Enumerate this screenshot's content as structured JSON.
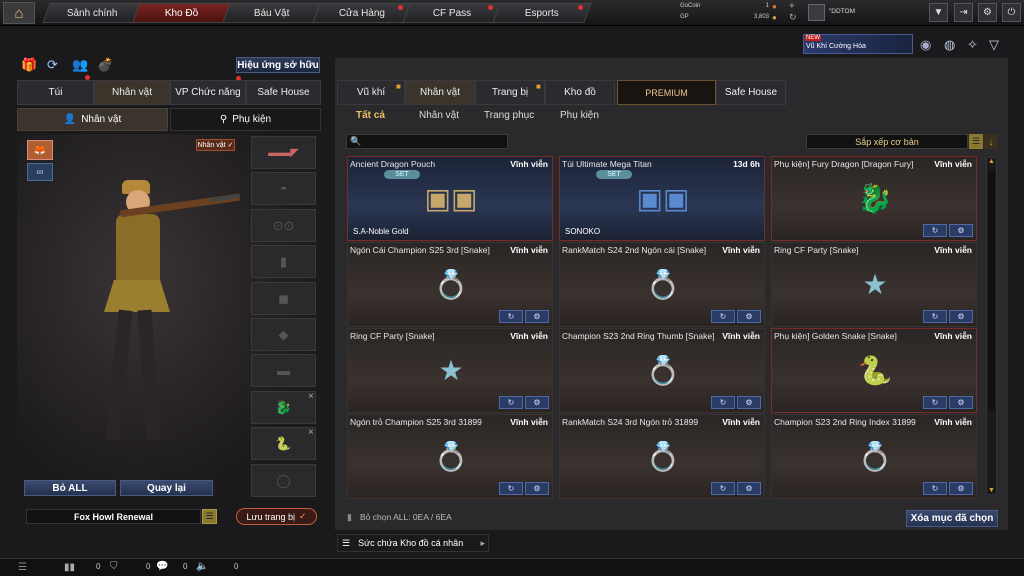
{
  "nav": {
    "tabs": [
      "Sảnh chính",
      "Kho Đồ",
      "Báu Vật",
      "Cửa Hàng",
      "CF Pass",
      "Esports"
    ],
    "active": "Kho Đồ"
  },
  "currency": {
    "gocoin_label": "GoCoin",
    "gocoin_value": "1",
    "gp_label": "GP",
    "gp_value": "3,803",
    "username": "\"DDTOM"
  },
  "promo": {
    "badge": "NEW",
    "text": "Vũ Khí Cường Hóa"
  },
  "left": {
    "effects_button": "Hiệu ứng sở hữu",
    "tabs": [
      "Túi",
      "Nhân vật",
      "VP Chức năng",
      "Safe House"
    ],
    "sub_tabs": [
      "Nhân vật",
      "Phụ kiện"
    ],
    "char_badge": "Nhân vật ✓",
    "remove_all": "Bỏ ALL",
    "back": "Quay lại",
    "preset_name": "Fox Howl Renewal",
    "save_button": "Lưu trang bị"
  },
  "right": {
    "tabs": [
      "Vũ khí",
      "Nhân vật",
      "Trang bị",
      "Kho đồ",
      "PREMIUM",
      "Safe House"
    ],
    "sub_tabs": [
      "Tất cả",
      "Nhân vật",
      "Trang phục",
      "Phụ kiện"
    ],
    "sort_label": "Sắp xếp cơ bản",
    "items": [
      {
        "name": "Ancient Dragon Pouch",
        "duration": "Vĩnh viễn",
        "set": "SET",
        "owner": "S.A-Noble Gold"
      },
      {
        "name": "Túi Ultimate Mega Titan",
        "duration": "13d 6h",
        "set": "SET",
        "owner": "SONOKO"
      },
      {
        "name": "Phụ kiện] Fury Dragon [Dragon Fury]",
        "duration": "Vĩnh viễn"
      },
      {
        "name": "Ngón Cái Champion S25 3rd [Snake]",
        "duration": "Vĩnh viễn"
      },
      {
        "name": "RankMatch S24 2nd Ngón cái [Snake]",
        "duration": "Vĩnh viễn"
      },
      {
        "name": "Ring CF Party [Snake]",
        "duration": "Vĩnh viễn"
      },
      {
        "name": "Ring CF Party [Snake]",
        "duration": "Vĩnh viễn"
      },
      {
        "name": "Champion S23 2nd Ring Thumb [Snake]",
        "duration": "Vĩnh viễn"
      },
      {
        "name": "Phụ kiện] Golden Snake [Snake]",
        "duration": "Vĩnh viễn"
      },
      {
        "name": "Ngón trỏ Champion S25 3rd 31899",
        "duration": "Vĩnh viễn"
      },
      {
        "name": "RankMatch S24 3rd Ngón trỏ 31899",
        "duration": "Vĩnh viễn"
      },
      {
        "name": "Champion S23 2nd Ring Index 31899",
        "duration": "Vĩnh viễn"
      }
    ],
    "deselect_text": "Bỏ chọn ALL: 0EA / 6EA",
    "delete_button": "Xóa mục đã chọn",
    "capacity_text": "Sức chứa Kho đồ cá nhân"
  },
  "bottom": {
    "count1": "0",
    "count2": "0",
    "count3": "0",
    "count4": "0"
  }
}
